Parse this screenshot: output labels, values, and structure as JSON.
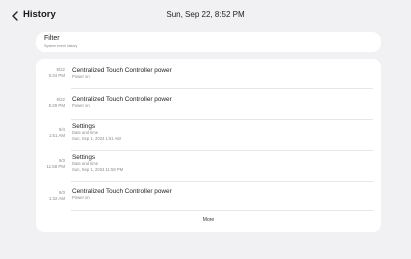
{
  "header": {
    "title": "History",
    "datetime": "Sun, Sep 22, 8:52 PM"
  },
  "filter": {
    "title": "Filter",
    "subtitle": "System event history"
  },
  "entries": [
    {
      "date": "9/22",
      "time": "5:34 PM",
      "title": "Centralized Touch Controller power",
      "line1": "Power on",
      "line2": ""
    },
    {
      "date": "9/22",
      "time": "5:29 PM",
      "title": "Centralized Touch Controller power",
      "line1": "Power on",
      "line2": ""
    },
    {
      "date": "9/4",
      "time": "1:51 AM",
      "title": "Settings",
      "line1": "Date and time",
      "line2": "Sun, Sep 1, 2024 1:51 AM"
    },
    {
      "date": "9/3",
      "time": "11:58 PM",
      "title": "Settings",
      "line1": "Date and time",
      "line2": "Sun, Sep 1, 2024 11:58 PM"
    },
    {
      "date": "9/3",
      "time": "1:32 AM",
      "title": "Centralized Touch Controller power",
      "line1": "Power on",
      "line2": ""
    }
  ],
  "more_label": "More"
}
